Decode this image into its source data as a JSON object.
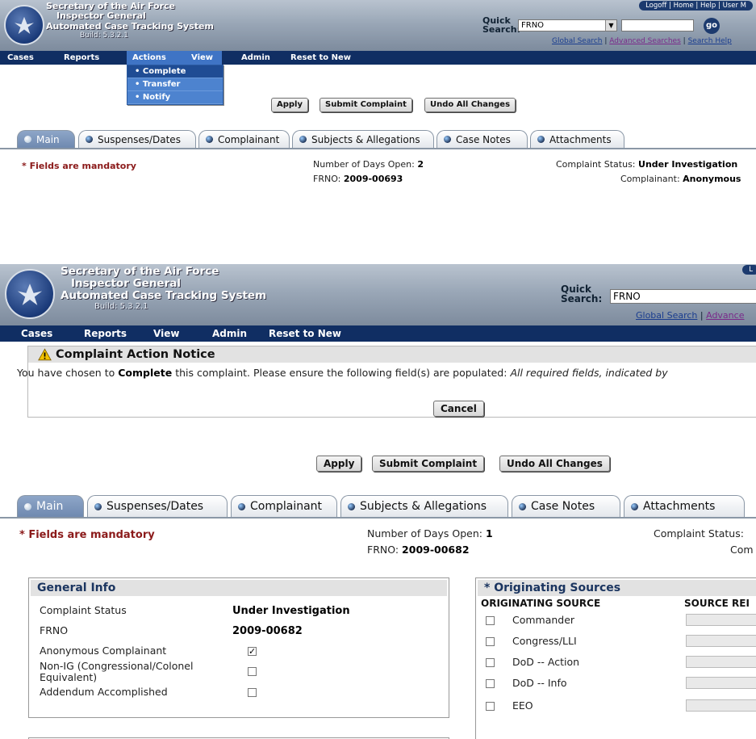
{
  "header": {
    "title1": "Secretary of the Air Force",
    "title2": "Inspector General",
    "title3": "Automated Case Tracking System",
    "build": "Build: 5.3.2.1",
    "toplinks": "Logoff | Home | Help | User M",
    "toplinks_short": "L",
    "quick_search_label": "Quick Search:",
    "quick_search_value": "FRNO",
    "go_label": "go",
    "global_search": "Global Search",
    "advanced_searches": "Advanced Searches",
    "advanced_short": "Advance",
    "search_help": "Search Help",
    "sep": "|"
  },
  "nav": {
    "cases": "Cases",
    "reports": "Reports",
    "actions": "Actions",
    "view": "View",
    "admin": "Admin",
    "reset": "Reset to New"
  },
  "actions_menu": [
    "Complete",
    "Transfer",
    "Notify"
  ],
  "toolbar": {
    "apply": "Apply",
    "submit": "Submit Complaint",
    "undo": "Undo All Changes"
  },
  "tabs": [
    "Main",
    "Suspenses/Dates",
    "Complainant",
    "Subjects & Allegations",
    "Case Notes",
    "Attachments"
  ],
  "mandatory": "* Fields are mandatory",
  "case1": {
    "days_label": "Number of Days Open:",
    "days": "2",
    "frno_label": "FRNO:",
    "frno": "2009-00693",
    "status_label": "Complaint Status:",
    "status": "Under Investigation",
    "complainant_label": "Complainant:",
    "complainant": "Anonymous"
  },
  "case2": {
    "days_label": "Number of Days Open:",
    "days": "1",
    "frno_label": "FRNO:",
    "frno": "2009-00682",
    "status_label": "Complaint Status:",
    "complainant_short": "Com"
  },
  "notice": {
    "title": "Complaint Action Notice",
    "text_pre": "You have chosen to",
    "action": "Complete",
    "text_mid": "this complaint. Please ensure the following field(s) are populated:",
    "text_italic": "All required fields, indicated by",
    "cancel": "Cancel"
  },
  "general_info": {
    "title": "General Info",
    "rows": [
      {
        "label": "Complaint Status",
        "value": "Under Investigation"
      },
      {
        "label": "FRNO",
        "value": "2009-00682"
      },
      {
        "label": "Anonymous Complainant",
        "checked": true
      },
      {
        "label": "Non-IG (Congressional/Colonel Equivalent)",
        "checked": false
      },
      {
        "label": "Addendum Accomplished",
        "checked": false
      }
    ]
  },
  "sources": {
    "title": "* Originating Sources",
    "col1": "ORIGINATING SOURCE",
    "col2": "SOURCE REI",
    "items": [
      "Commander",
      "Congress/LLI",
      "DoD -- Action",
      "DoD -- Info",
      "EEO"
    ]
  }
}
